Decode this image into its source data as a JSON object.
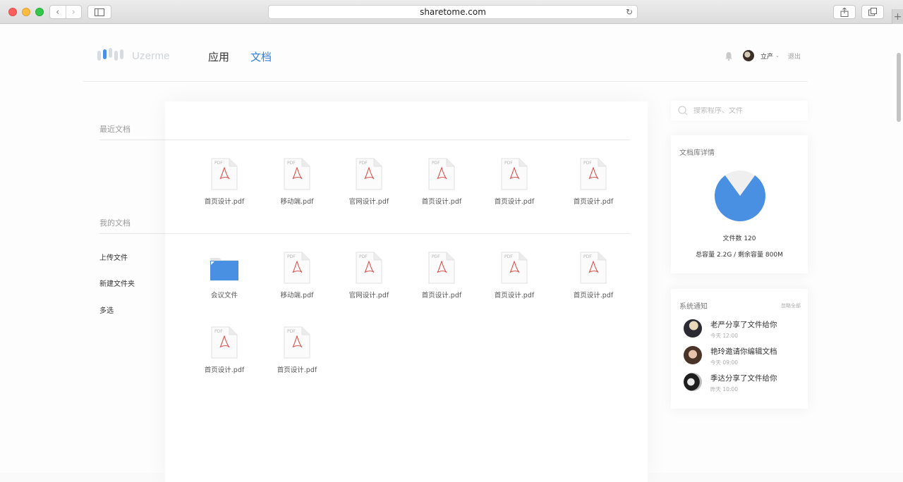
{
  "browser": {
    "url": "sharetome.com",
    "back_icon": "chevron-left-icon",
    "forward_icon": "chevron-right-icon"
  },
  "header": {
    "logo_text": "Uzerme",
    "nav": [
      {
        "label": "应用",
        "active": false
      },
      {
        "label": "文档",
        "active": true
      }
    ],
    "user_name": "立产",
    "logout_label": "退出"
  },
  "sidebar": {
    "recent_title": "最近文档",
    "my_docs_title": "我的文档",
    "actions": [
      "上传文件",
      "新建文件夹",
      "多选"
    ]
  },
  "recent_files": [
    {
      "name": "首页设计.pdf",
      "type": "pdf"
    },
    {
      "name": "移动端.pdf",
      "type": "pdf"
    },
    {
      "name": "官网设计.pdf",
      "type": "pdf"
    },
    {
      "name": "首页设计.pdf",
      "type": "pdf"
    },
    {
      "name": "首页设计.pdf",
      "type": "pdf"
    },
    {
      "name": "首页设计.pdf",
      "type": "pdf"
    }
  ],
  "my_files": [
    {
      "name": "会议文件",
      "type": "folder"
    },
    {
      "name": "移动端.pdf",
      "type": "pdf"
    },
    {
      "name": "官网设计.pdf",
      "type": "pdf"
    },
    {
      "name": "首页设计.pdf",
      "type": "pdf"
    },
    {
      "name": "首页设计.pdf",
      "type": "pdf"
    },
    {
      "name": "首页设计.pdf",
      "type": "pdf"
    },
    {
      "name": "首页设计.pdf",
      "type": "pdf"
    },
    {
      "name": "首页设计.pdf",
      "type": "pdf"
    }
  ],
  "file_icon_tag": "PDF",
  "search": {
    "placeholder": "搜索程序、文件"
  },
  "library": {
    "title": "文档库详情",
    "used_fraction": 0.8,
    "file_count_text": "文件数 120",
    "capacity_text": "总容量 2.2G / 剩余容量 800M"
  },
  "notifications": {
    "title": "系统通知",
    "mark_all": "忽略全部",
    "items": [
      {
        "message": "老严分享了文件给你",
        "time": "今天  12:00"
      },
      {
        "message": "艳玲邀请你编辑文档",
        "time": "今天  09:00"
      },
      {
        "message": "季达分享了文件给你",
        "time": "昨天  10:00"
      }
    ]
  },
  "colors": {
    "accent": "#2f7fe0",
    "pie": "#4a90e2",
    "folder": "#4a90e2",
    "pdf_red": "#d9534f"
  }
}
